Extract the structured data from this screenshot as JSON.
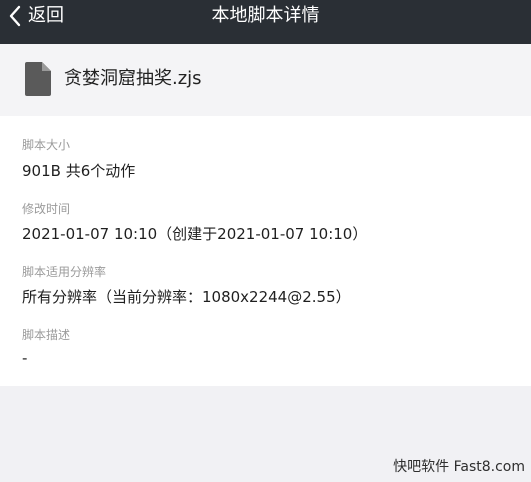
{
  "header": {
    "back_label": "返回",
    "title": "本地脚本详情"
  },
  "file": {
    "name": "贪婪洞窟抽奖.zjs",
    "icon": "document-icon"
  },
  "details": {
    "size_label": "脚本大小",
    "size_value": "901B  共6个动作",
    "modified_label": "修改时间",
    "modified_value": "2021-01-07 10:10（创建于2021-01-07 10:10）",
    "resolution_label": "脚本适用分辨率",
    "resolution_value": "所有分辨率（当前分辨率：1080x2244@2.55）",
    "desc_label": "脚本描述",
    "desc_value": "-"
  },
  "watermark": "快吧软件 Fast8.com",
  "colors": {
    "topbar": "#2a2f35",
    "page_bg": "#f1f1f4",
    "card_bg": "#ffffff",
    "label_gray": "#9b9b9b",
    "text_dark": "#1f1f1f"
  }
}
